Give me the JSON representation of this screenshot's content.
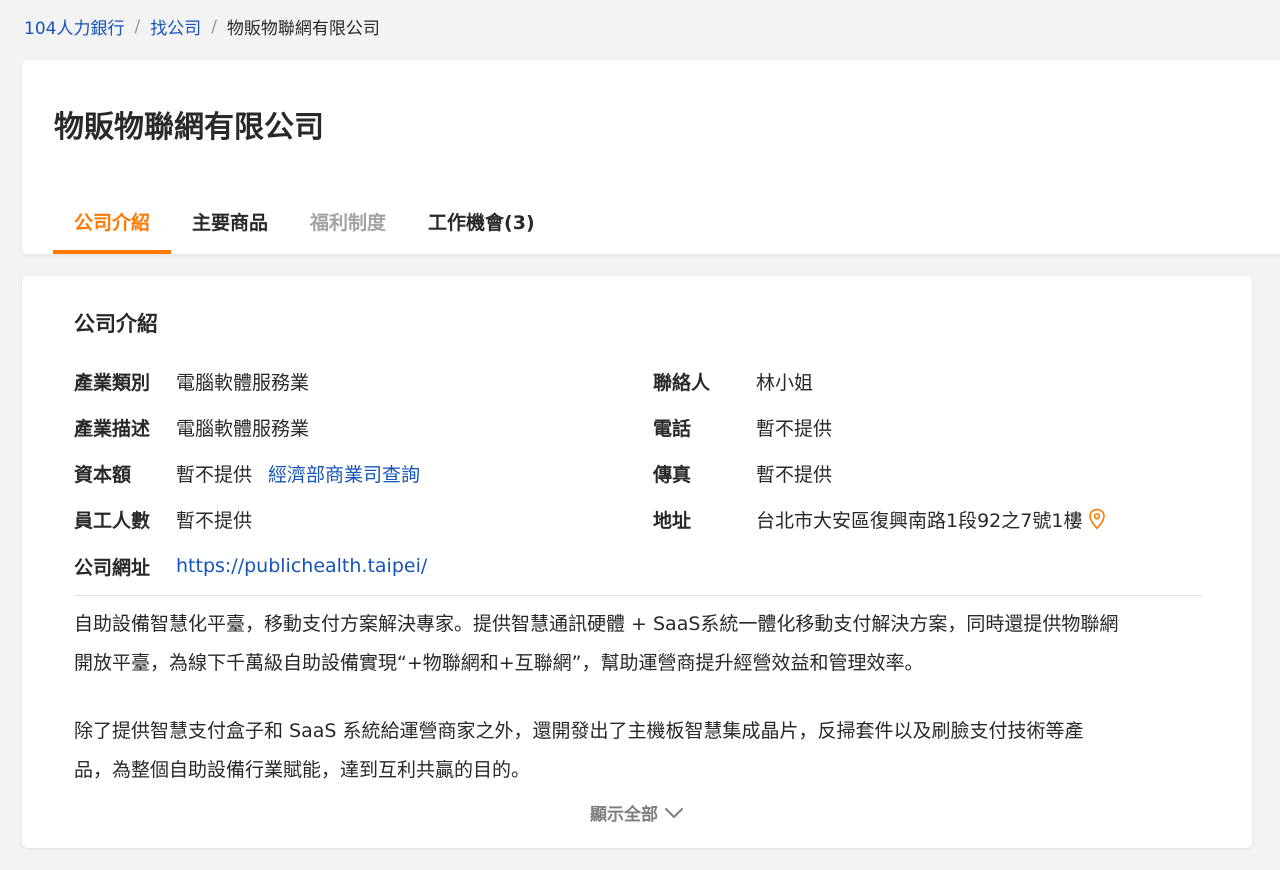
{
  "breadcrumb": {
    "home": "104人力銀行",
    "find_company": "找公司",
    "current": "物販物聯網有限公司"
  },
  "company": {
    "name": "物販物聯網有限公司"
  },
  "tabs": [
    {
      "label": "公司介紹",
      "state": "active"
    },
    {
      "label": "主要商品",
      "state": "normal"
    },
    {
      "label": "福利制度",
      "state": "disabled"
    },
    {
      "label": "工作機會(3)",
      "state": "normal"
    }
  ],
  "intro": {
    "title": "公司介紹",
    "industry_label": "產業類別",
    "industry_value": "電腦軟體服務業",
    "industry_desc_label": "產業描述",
    "industry_desc_value": "電腦軟體服務業",
    "capital_label": "資本額",
    "capital_value": "暫不提供",
    "capital_link": "經濟部商業司查詢",
    "employees_label": "員工人數",
    "employees_value": "暫不提供",
    "website_label": "公司網址",
    "website_value": "https://publichealth.taipei/",
    "contact_label": "聯絡人",
    "contact_value": "林小姐",
    "phone_label": "電話",
    "phone_value": "暫不提供",
    "fax_label": "傳真",
    "fax_value": "暫不提供",
    "address_label": "地址",
    "address_value": "台北市大安區復興南路1段92之7號1樓",
    "paragraph1_line1": "自助設備智慧化平臺，移動支付方案解決專家。提供智慧通訊硬體 + SaaS系統一體化移動支付解決方案，同時還提供物聯網",
    "paragraph1_line2": "開放平臺，為線下千萬級自助設備實現“+物聯網和+互聯網”，幫助運營商提升經營效益和管理效率。",
    "paragraph2_line1": "除了提供智慧支付盒子和 SaaS 系統給運營商家之外，還開發出了主機板智慧集成晶片，反掃套件以及刷臉支付技術等產",
    "paragraph2_line2": "品，為整個自助設備行業賦能，達到互利共贏的目的。",
    "show_all": "顯示全部"
  },
  "colors": {
    "accent": "#ff7800",
    "link": "#1654b9",
    "text": "#292929",
    "muted": "#a3a3a3"
  },
  "icons": {
    "map_pin": "map-pin-icon",
    "chevron": "chevron-down-icon"
  }
}
